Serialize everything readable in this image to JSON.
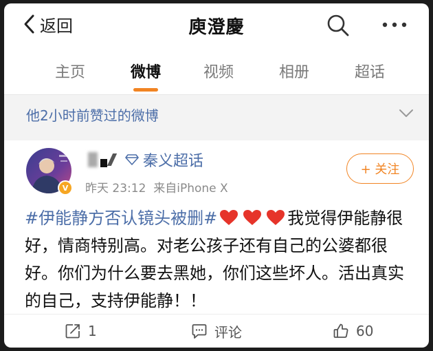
{
  "header": {
    "back_label": "返回",
    "title": "庾澄慶"
  },
  "tabs": [
    {
      "label": "主页",
      "active": false
    },
    {
      "label": "微博",
      "active": true
    },
    {
      "label": "视频",
      "active": false
    },
    {
      "label": "相册",
      "active": false
    },
    {
      "label": "超话",
      "active": false
    }
  ],
  "notice": {
    "text": "他2小时前赞过的微博"
  },
  "post": {
    "supertopic": "秦义超话",
    "time": "昨天 23:12",
    "source": "来自iPhone X",
    "follow_label": "+ 关注",
    "hashtag": "#伊能静方否认镜头被删#",
    "text": "我觉得伊能静很好，情商特别高。对老公孩子还有自己的公婆都很好。你们为什么要去黑她，你们这些坏人。活出真实的自己，支持伊能静！！",
    "hearts": 3
  },
  "actions": {
    "repost_count": "1",
    "comment_label": "评论",
    "like_count": "60"
  },
  "colors": {
    "accent": "#f18423",
    "link": "#4c6ea8",
    "heart": "#e6342a"
  },
  "icons": [
    "back-chevron-icon",
    "search-icon",
    "more-dots-icon",
    "chevron-down-icon",
    "diamond-icon",
    "verified-badge-icon",
    "heart-icon",
    "repost-icon",
    "comment-icon",
    "like-icon"
  ]
}
